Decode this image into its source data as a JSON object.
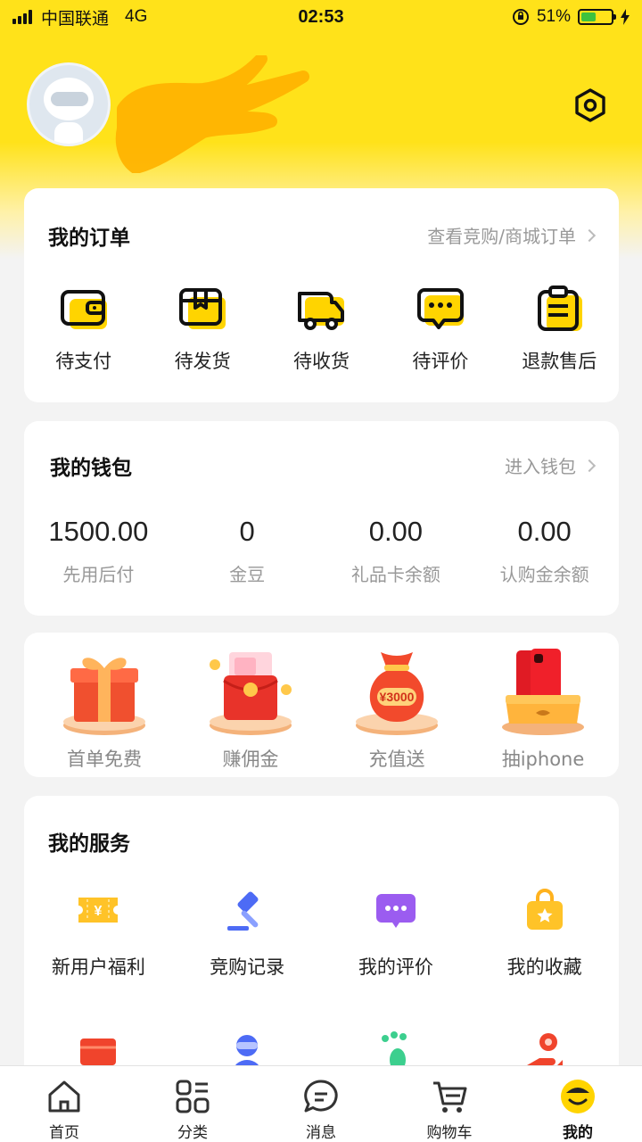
{
  "status_bar": {
    "carrier": "中国联通",
    "network": "4G",
    "time": "02:53",
    "battery_percent": "51%",
    "battery_level": 0.51
  },
  "header": {
    "settings_icon": "hexagon-settings-icon"
  },
  "orders": {
    "title": "我的订单",
    "link": "查看竞购/商城订单",
    "items": [
      {
        "label": "待支付",
        "icon": "wallet-icon"
      },
      {
        "label": "待发货",
        "icon": "package-icon"
      },
      {
        "label": "待收货",
        "icon": "truck-icon"
      },
      {
        "label": "待评价",
        "icon": "comment-icon"
      },
      {
        "label": "退款售后",
        "icon": "clipboard-icon"
      }
    ]
  },
  "wallet": {
    "title": "我的钱包",
    "link": "进入钱包",
    "items": [
      {
        "value": "1500.00",
        "label": "先用后付"
      },
      {
        "value": "0",
        "label": "金豆"
      },
      {
        "value": "0.00",
        "label": "礼品卡余额"
      },
      {
        "value": "0.00",
        "label": "认购金余额"
      }
    ]
  },
  "promos": {
    "items": [
      {
        "label": "首单免费",
        "icon": "gift-box-icon"
      },
      {
        "label": "赚佣金",
        "icon": "red-envelope-icon"
      },
      {
        "label": "充值送",
        "icon": "money-bag-icon",
        "badge": "¥3000"
      },
      {
        "label": "抽iphone",
        "icon": "iphone-prize-icon"
      }
    ]
  },
  "services": {
    "title": "我的服务",
    "items": [
      {
        "label": "新用户福利",
        "icon": "coupon-icon"
      },
      {
        "label": "竞购记录",
        "icon": "auction-hammer-icon"
      },
      {
        "label": "我的评价",
        "icon": "chat-bubble-icon"
      },
      {
        "label": "我的收藏",
        "icon": "favorite-bag-icon"
      }
    ],
    "more_icons": [
      "red-card-icon",
      "customer-service-icon",
      "footprint-icon",
      "share-hand-icon"
    ]
  },
  "tabbar": {
    "items": [
      {
        "label": "首页",
        "icon": "home-icon"
      },
      {
        "label": "分类",
        "icon": "category-icon"
      },
      {
        "label": "消息",
        "icon": "message-icon"
      },
      {
        "label": "购物车",
        "icon": "cart-icon"
      },
      {
        "label": "我的",
        "icon": "mine-face-icon",
        "active": true
      }
    ]
  },
  "colors": {
    "brand_yellow": "#ffe21a",
    "accent_yellow": "#ffd400",
    "background": "#f3f3f3"
  }
}
